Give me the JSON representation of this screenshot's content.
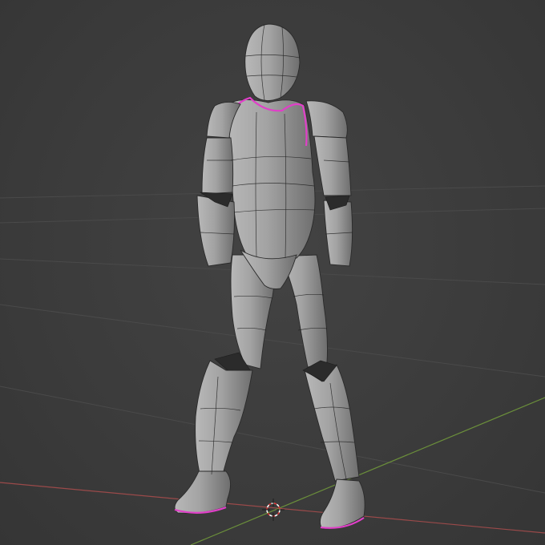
{
  "colors": {
    "viewport_bg": "#3d3d3d",
    "grid_line": "#4a4a4a",
    "x_axis": "#9b4a4a",
    "y_axis": "#6b8f3b",
    "selection_edge": "#e040c8",
    "mesh_surface": "#9a9a9a"
  },
  "viewport": {
    "view": "perspective",
    "shading": "solid-with-wireframe",
    "selected_object": "humanoid-base-mesh"
  },
  "icons": {
    "cursor": "3d-cursor-icon"
  }
}
